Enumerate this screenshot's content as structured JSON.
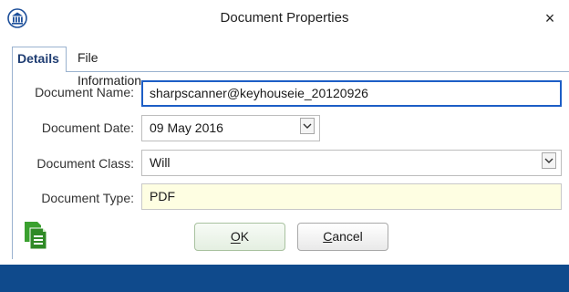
{
  "window": {
    "title": "Document Properties",
    "close_label": "×"
  },
  "tabs": [
    {
      "label": "Details",
      "active": true
    },
    {
      "label": "File Information",
      "active": false
    }
  ],
  "form": {
    "document_name": {
      "label": "Document Name:",
      "value": "sharpscanner@keyhouseie_20120926"
    },
    "document_date": {
      "label": "Document Date:",
      "value": "09 May 2016"
    },
    "document_class": {
      "label": "Document Class:",
      "value": "Will"
    },
    "document_type": {
      "label": "Document Type:",
      "value": "PDF"
    }
  },
  "buttons": {
    "ok": {
      "label": "OK",
      "mnemonic": "O"
    },
    "cancel": {
      "label": "Cancel",
      "mnemonic": "C"
    }
  },
  "icons": {
    "logo": "columns-seal-icon",
    "close": "close-icon",
    "dropdown": "chevron-down-icon",
    "documents": "documents-icon"
  },
  "colors": {
    "accent": "#1d5ec6",
    "tab_text": "#1f3d72",
    "readonly_bg": "#fefee2",
    "statusbar": "#0f4a8c",
    "icon_green": "#3aa02f"
  }
}
